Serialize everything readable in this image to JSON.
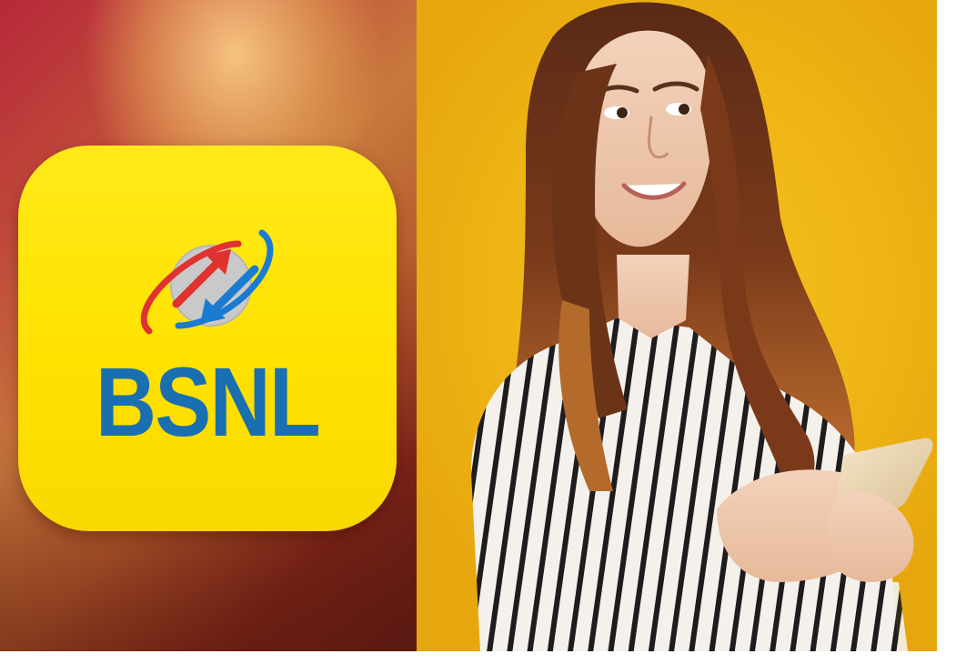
{
  "brand": {
    "name": "BSNL",
    "text_color": "#1a6fb0",
    "icon_background": "#ffe200",
    "arrow_red": "#e0322f",
    "arrow_blue": "#1a7bd0"
  },
  "photo": {
    "subject": "woman-holding-smartphone",
    "background_color": "#f2bb18"
  }
}
